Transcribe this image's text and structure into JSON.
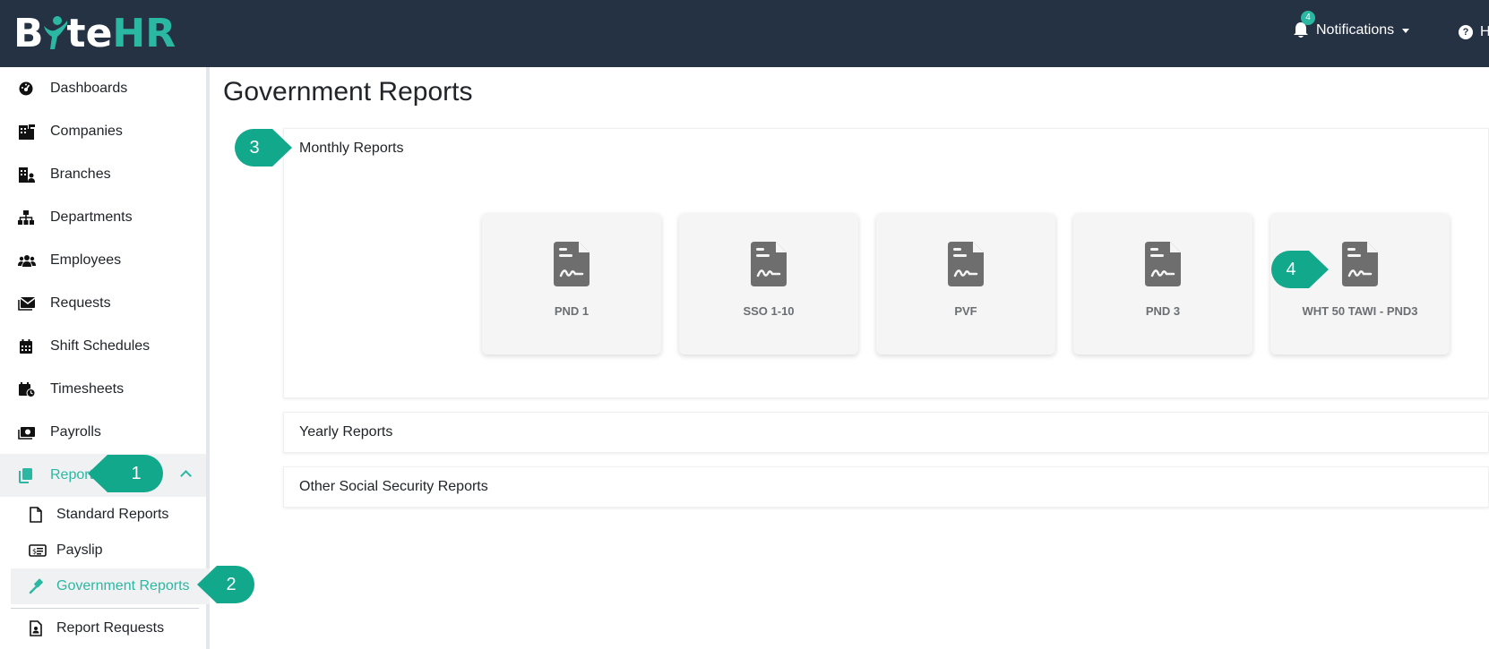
{
  "app": {
    "logo_parts": [
      "B",
      "te",
      "HR"
    ]
  },
  "topbar": {
    "notifications_label": "Notifications",
    "notifications_count": "4",
    "help_label": "H"
  },
  "sidebar": {
    "items": [
      {
        "label": "Dashboards",
        "icon": "dashboard-icon"
      },
      {
        "label": "Companies",
        "icon": "building-icon"
      },
      {
        "label": "Branches",
        "icon": "branch-icon"
      },
      {
        "label": "Departments",
        "icon": "sitemap-icon"
      },
      {
        "label": "Employees",
        "icon": "users-icon"
      },
      {
        "label": "Requests",
        "icon": "envelope-icon"
      },
      {
        "label": "Shift Schedules",
        "icon": "calendar-icon"
      },
      {
        "label": "Timesheets",
        "icon": "calendar-clock-icon"
      },
      {
        "label": "Payrolls",
        "icon": "money-icon"
      },
      {
        "label": "Reports",
        "icon": "copy-icon"
      }
    ],
    "report_subitems": [
      {
        "label": "Standard Reports",
        "icon": "file-icon"
      },
      {
        "label": "Payslip",
        "icon": "id-card-icon"
      },
      {
        "label": "Government Reports",
        "icon": "gavel-icon"
      },
      {
        "label": "Report Requests",
        "icon": "file-user-icon"
      }
    ]
  },
  "main": {
    "title": "Government Reports",
    "sections": [
      {
        "title": "Monthly Reports"
      },
      {
        "title": "Yearly Reports"
      },
      {
        "title": "Other Social Security Reports"
      }
    ],
    "monthly_cards": [
      {
        "label": "PND 1",
        "icon": "file-signature-icon"
      },
      {
        "label": "SSO 1-10",
        "icon": "file-signature-icon"
      },
      {
        "label": "PVF",
        "icon": "file-signature-icon"
      },
      {
        "label": "PND 3",
        "icon": "file-signature-icon"
      },
      {
        "label": "WHT 50 TAWI - PND3",
        "icon": "file-signature-icon"
      }
    ]
  },
  "callouts": [
    "1",
    "2",
    "3",
    "4"
  ],
  "colors": {
    "topbar": "#253244",
    "accent": "#2bb8a3",
    "callout": "#12a88b",
    "card_bg": "#f5f5f5",
    "icon_gray": "#6e6e6e"
  }
}
